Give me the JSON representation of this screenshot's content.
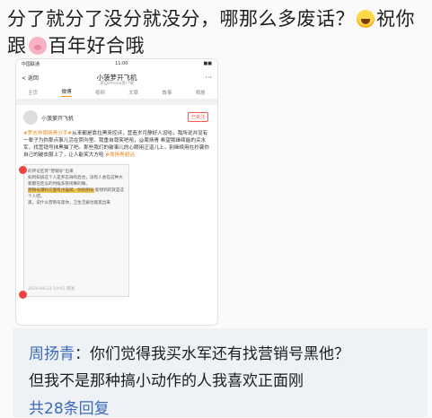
{
  "post": {
    "line1": "分了就分了没分就没分，哪那么多废话？",
    "line1_tail": "祝你",
    "line2_head": "跟",
    "line2_tail": "百年好合哦",
    "emoji1": "laughing-emoji",
    "emoji2": "pig-emoji"
  },
  "screenshot": {
    "status": {
      "carrier": "中国联通",
      "time": "11:00",
      "battery": "■■"
    },
    "nav": {
      "back": "< 返回",
      "title": "小菠萝开飞机",
      "subtitle": "来自iPhone客户端",
      "more": "···"
    },
    "tabs": [
      {
        "label": "主页"
      },
      {
        "label": "微博"
      },
      {
        "label": "视频"
      },
      {
        "label": "文章"
      },
      {
        "label": "故事"
      },
      {
        "label": "相册"
      }
    ],
    "author": {
      "name": "小菠萝开飞机",
      "meta": "",
      "follow": "已关注"
    },
    "text": {
      "tag": "#罗志祥周扬青分手#",
      "body": "从来都是靠拉黑来控评，营造岁月静好人设哈，我所说并没有一辈子为你那点事儿活在阴沟里。我重自尊笑吧哈，@周扬青 希望我继续能的买水军，找营销号抹黑猫了吧。那些我们的破事儿的心眼用正道儿上，别继续用在抄袭你自己的破衣服上了，让人能笑大方哈",
      "tag2": "#周扬青超话"
    },
    "inner": {
      "text1": "的评论区有“营销号”出来",
      "text2": "如何知道这个人是罗志祥的后台，没有人会在这种大家都在吃瓜的时候多管闲事的嘛。",
      "highlight1": "营销号爆料方面有点猫腻，你的阴号",
      "text3": "能想到的就是这个人吧。",
      "text4": "黑，说什么营销号黑你，卫生洁癖也能黑出来",
      "footer": "2020-04-23 10:02 转发"
    }
  },
  "quote": {
    "who": "周扬青",
    "line1": "：你们觉得我买水军还有找营销号黑他？",
    "line2": "但我不是那种搞小动作的人我喜欢正面刚",
    "more": "共28条回复"
  }
}
